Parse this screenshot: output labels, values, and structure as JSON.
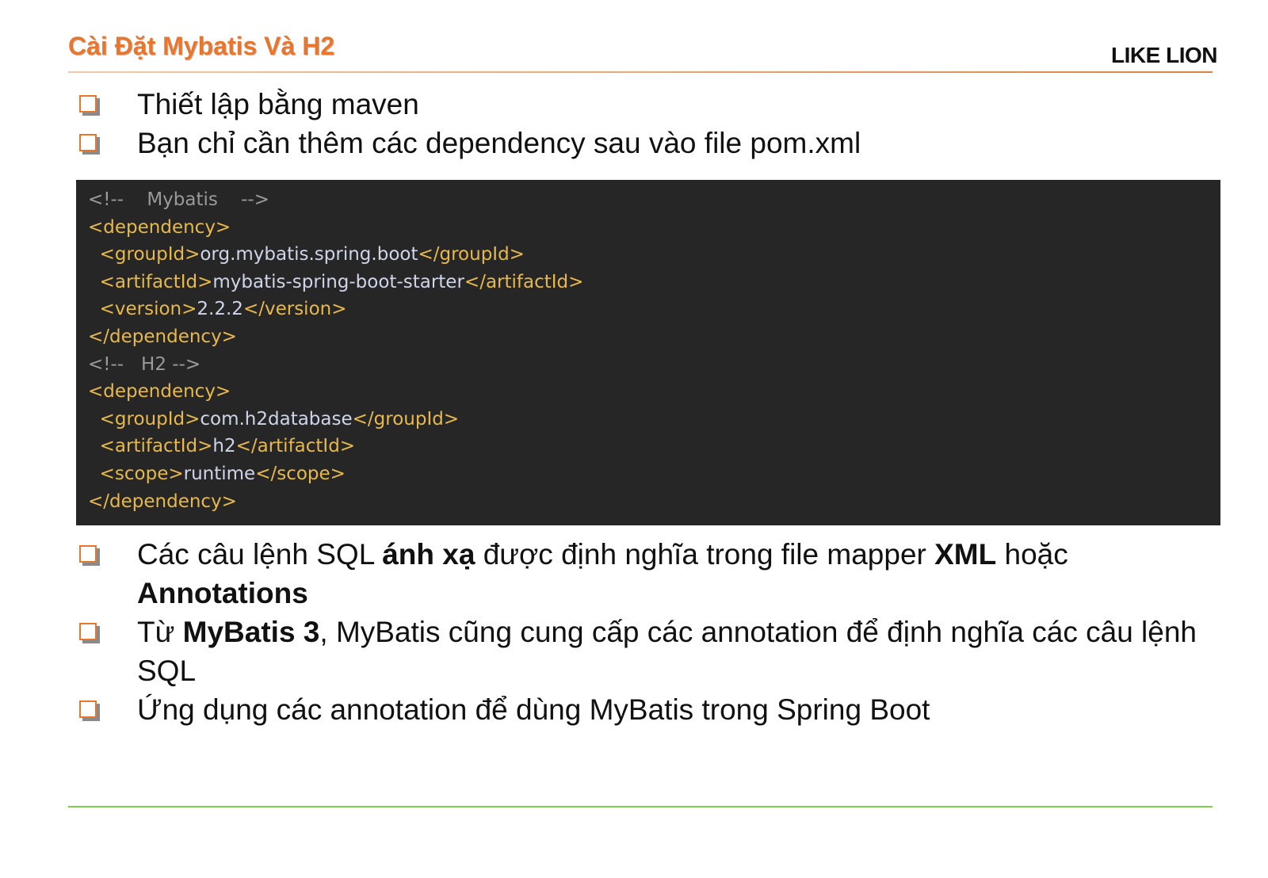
{
  "header": {
    "title": "Cài Đặt Mybatis Và H2",
    "brand": "LIKE LION"
  },
  "bullets_top": [
    {
      "text": "Thiết lập bằng maven"
    },
    {
      "text": "Bạn chỉ cần thêm các dependency sau vào file pom.xml"
    }
  ],
  "code": {
    "l1": {
      "comment": "<!--    Mybatis    -->"
    },
    "l2": {
      "open": "<dependency>"
    },
    "l3": {
      "indent": "  ",
      "open": "<groupId>",
      "value": "org.mybatis.spring.boot",
      "close": "</groupId>"
    },
    "l4": {
      "indent": "  ",
      "open": "<artifactId>",
      "value": "mybatis-spring-boot-starter",
      "close": "</artifactId>"
    },
    "l5": {
      "indent": "  ",
      "open": "<version>",
      "value": "2.2.2",
      "close": "</version>"
    },
    "l6": {
      "close": "</dependency>"
    },
    "l7": {
      "comment": "<!--   H2 -->"
    },
    "l8": {
      "open": "<dependency>"
    },
    "l9": {
      "indent": "  ",
      "open": "<groupId>",
      "value": "com.h2database",
      "close": "</groupId>"
    },
    "l10": {
      "indent": "  ",
      "open": "<artifactId>",
      "value": "h2",
      "close": "</artifactId>"
    },
    "l11": {
      "indent": "  ",
      "open": "<scope>",
      "value": "runtime",
      "close": "</scope>"
    },
    "l12": {
      "close": "</dependency>"
    }
  },
  "bullets_bottom": {
    "b1": {
      "t1": "Các câu lệnh SQL ",
      "b1": "ánh xạ",
      "t2": " được định nghĩa trong file mapper ",
      "b2": "XML",
      "t3": " hoặc ",
      "b3": "Annotations"
    },
    "b2": {
      "t1": "Từ ",
      "b1": "MyBatis 3",
      "t2": ", MyBatis cũng cung cấp các annotation để định nghĩa các câu lệnh SQL"
    },
    "b3": {
      "t1": "Ứng dụng các annotation để dùng MyBatis trong Spring Boot"
    }
  },
  "colors": {
    "title": "#e8762d",
    "code_background": "#262626",
    "code_tag": "#e7b84a",
    "code_text": "#cfd5e8",
    "code_comment": "#9a9a9a",
    "bottom_rule": "#7ccf4a"
  }
}
